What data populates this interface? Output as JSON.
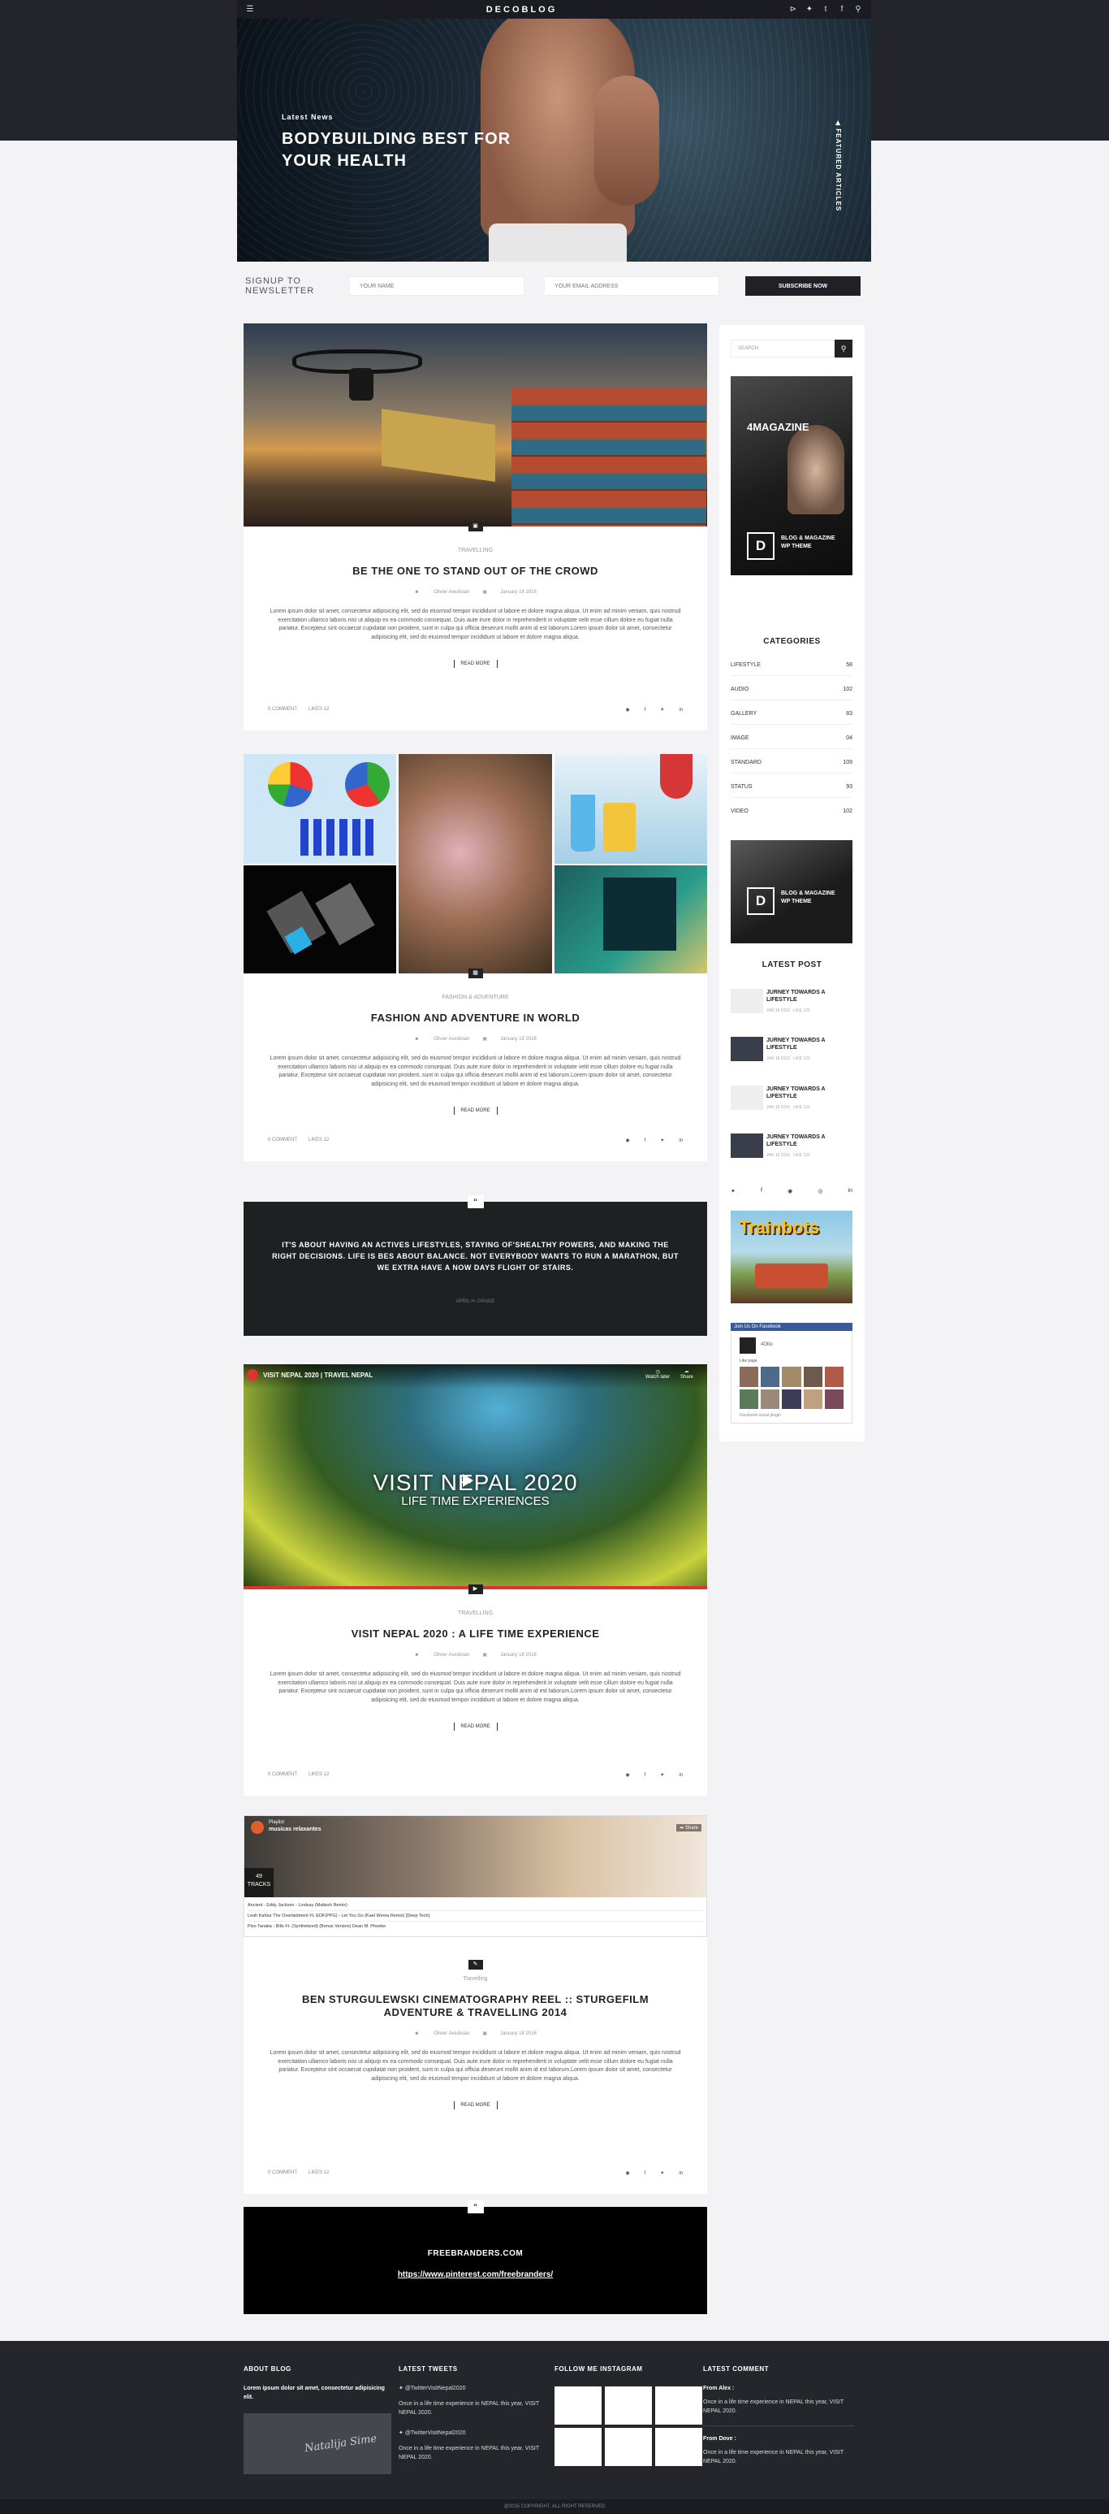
{
  "header": {
    "logo": "DECOBLOG",
    "menu_icon": "menu-icon",
    "social": [
      "rss-icon",
      "twitter-icon",
      "tumblr-icon",
      "facebook-icon",
      "search-icon"
    ]
  },
  "hero": {
    "label": "Latest News",
    "title": "BODYBUILDING BEST FOR YOUR HEALTH",
    "side_label": "FEATURED ARTICLES"
  },
  "newsletter": {
    "title": "SIGNUP TO NEWSLETTER",
    "name_placeholder": "YOUR NAME",
    "email_placeholder": "YOUR EMAIL ADDRESS",
    "button": "SUBSCRIBE NOW"
  },
  "posts": [
    {
      "category": "TRAVELLING",
      "title": "BE THE ONE TO STAND OUT OF THE CROWD",
      "author": "Olivier Avedisian",
      "date": "January 18 2016",
      "excerpt": "Lorem ipsum dolor sit amet, consectetur adipisicing elit, sed do eiusmod tempor incididunt ut labore et dolore magna aliqua. Ut enim ad minim veniam, quis nostrud exercitation ullamco laboris nisi ut aliquip ex ea commodo consequat. Duis aute irure dolor in reprehenderit in voluptate velit esse cillum dolore eu fugiat nulla pariatur. Excepteur sint occaecat cupidatat non proident, sunt in culpa qui officia deserunt mollit anim id est laborum.Lorem ipsum dolor sit amet, consectetur adipisicing elit, sed do eiusmod tempor incididunt ut labore et dolore magna aliqua.",
      "more": "READ MORE",
      "comments": "0 COMMENT",
      "likes": "LIKES 12"
    },
    {
      "category": "FASHION & ADVENTURE",
      "title": "FASHION AND ADVENTURE IN WORLD",
      "author": "Olivier Avedisian",
      "date": "January 18 2016",
      "excerpt": "Lorem ipsum dolor sit amet, consectetur adipisicing elit, sed do eiusmod tempor incididunt ut labore et dolore magna aliqua. Ut enim ad minim veniam, quis nostrud exercitation ullamco laboris nisi ut aliquip ex ea commodo consequat. Duis aute irure dolor in reprehenderit in voluptate velit esse cillum dolore eu fugiat nulla pariatur. Excepteur sint occaecat cupidatat non proident, sunt in culpa qui officia deserunt mollit anim id est laborum.Lorem ipsum dolor sit amet, consectetur adipisicing elit, sed do eiusmod tempor incididunt ut labore et dolore magna aliqua.",
      "more": "READ MORE",
      "comments": "0 COMMENT",
      "likes": "LIKES 12"
    },
    {
      "category": "TRAVELLING",
      "title": "VISIT NEPAL 2020 : A LIFE TIME EXPERIENCE",
      "author": "Olivier Avedisian",
      "date": "January 18 2016",
      "excerpt": "Lorem ipsum dolor sit amet, consectetur adipisicing elit, sed do eiusmod tempor incididunt ut labore et dolore magna aliqua. Ut enim ad minim veniam, quis nostrud exercitation ullamco laboris nisi ut aliquip ex ea commodo consequat. Duis aute irure dolor in reprehenderit in voluptate velit esse cillum dolore eu fugiat nulla pariatur. Excepteur sint occaecat cupidatat non proident, sunt in culpa qui officia deserunt mollit anim id est laborum.Lorem ipsum dolor sit amet, consectetur adipisicing elit, sed do eiusmod tempor incididunt ut labore et dolore magna aliqua.",
      "more": "READ MORE",
      "comments": "0 COMMENT",
      "likes": "LIKES 12"
    },
    {
      "category": "Travelling",
      "title": "BEN STURGULEWSKI CINEMATOGRAPHY REEL :: STURGEFILM ADVENTURE & TRAVELLING 2014",
      "author": "Olivier Avedisian",
      "date": "January 18 2016",
      "excerpt": "Lorem ipsum dolor sit amet, consectetur adipisicing elit, sed do eiusmod tempor incididunt ut labore et dolore magna aliqua. Ut enim ad minim veniam, quis nostrud exercitation ullamco laboris nisi ut aliquip ex ea commodo consequat. Duis aute irure dolor in reprehenderit in voluptate velit esse cillum dolore eu fugiat nulla pariatur. Excepteur sint occaecat cupidatat non proident, sunt in culpa qui officia deserunt mollit anim id est laborum.Lorem ipsum dolor sit amet, consectetur adipisicing elit, sed do eiusmod tempor incididunt ut labore et dolore magna aliqua.",
      "more": "READ MORE",
      "comments": "0 COMMENT",
      "likes": "LIKES 12"
    }
  ],
  "quote": {
    "text": "IT'S ABOUT HAVING AN ACTIVES LIFESTYLES, STAYING OF'SHEALTHY POWERS, AND MAKING THE RIGHT DECISIONS. LIFE IS BES ABOUT BALANCE. NOT EVERYBODY WANTS TO RUN A MARATHON, BUT WE EXTRA HAVE A NOW DAYS FLIGHT OF STAIRS.",
    "author": "APRIL H. GRADE"
  },
  "video1": {
    "title": "VISIT NEPAL 2020 | TRAVEL NEPAL",
    "big": "VISIT NEPAL 2020",
    "sub": "LIFE TIME EXPERIENCES",
    "watch": "Watch later",
    "share": "Share"
  },
  "video2": {
    "channel": "Playlist",
    "subtitle": "musicas relaxantes",
    "count": "49",
    "tracks": "TRACKS",
    "tracklist": [
      "Ancient - Eddy Jackson - Lindsay (Maltesh Remix)",
      "Leah Kahlur The Overlaidment Ft. EDF(PPG) - Let You Go (Kael Wema Remix) [Deep Tech]",
      "Piso Tanaka - Bills Ft. (Synthetized) (Bonus Version) Dean M. Phoebe"
    ],
    "share": "Share"
  },
  "link": {
    "title": "FREEBRANDERS.COM",
    "url": "https://www.pinterest.com/freebranders/"
  },
  "sidebar": {
    "search_placeholder": "SEARCH",
    "ad1": {
      "title": "4MAGAZINE",
      "d": "D",
      "text": "BLOG & MAGAZINE WP THEME"
    },
    "categories_title": "CATEGORIES",
    "categories": [
      {
        "name": "LIFESTYLE",
        "count": "58"
      },
      {
        "name": "AUDIO",
        "count": "102"
      },
      {
        "name": "GALLERY",
        "count": "83"
      },
      {
        "name": "IMAGE",
        "count": "04"
      },
      {
        "name": "STANDARD",
        "count": "109"
      },
      {
        "name": "STATUS",
        "count": "93"
      },
      {
        "name": "VIDEO",
        "count": "102"
      }
    ],
    "ad2": {
      "d": "D",
      "text": "BLOG & MAGAZINE WP THEME"
    },
    "latest_title": "LATEST POST",
    "latest": [
      {
        "title": "JURNEY TOWARDS A LIFESTYLE",
        "date": "JAN 18 2016",
        "likes": "LIKE 120"
      },
      {
        "title": "JURNEY TOWARDS A LIFESTYLE",
        "date": "JAN 18 2016",
        "likes": "LIKE 120"
      },
      {
        "title": "JURNEY TOWARDS A LIFESTYLE",
        "date": "JAN 18 2016",
        "likes": "LIKE 120"
      },
      {
        "title": "JURNEY TOWARDS A LIFESTYLE",
        "date": "JAN 18 2016",
        "likes": "LIKE 120"
      }
    ],
    "banner": "Trainbots",
    "fb": {
      "header": "Join Us On Facebook",
      "name": "4Otto",
      "likes": "Like page",
      "plugin": "Facebook social plugin"
    }
  },
  "footer": {
    "about_title": "ABOUT BLOG",
    "about_text": "Lorem ipsum dolor sit amet, consectetur adipisicing elit.",
    "signature": "Natalija Sime",
    "tweets_title": "LATEST TWEETS",
    "tweets": [
      {
        "handle": "@TwitterVisitNepal2020",
        "text": "Once in a life time experience in NEPAL this year, VISIT NEPAL 2020."
      },
      {
        "handle": "@TwitterVisitNepal2020",
        "text": "Once in a life time experience in NEPAL this year, VISIT NEPAL 2020."
      }
    ],
    "instagram_title": "FOLLOW ME INSTAGRAM",
    "comments_title": "LATEST COMMENT",
    "comments": [
      {
        "from": "From Alex :",
        "text": "Once in a life time experience in NEPAL this year, VISIT NEPAL 2020."
      },
      {
        "from": "From Dove :",
        "text": "Once in a life time experience in NEPAL this year, VISIT NEPAL 2020."
      }
    ],
    "copyright": "@2015 COPYRIGHT. ALL RIGHT RESERVED"
  }
}
